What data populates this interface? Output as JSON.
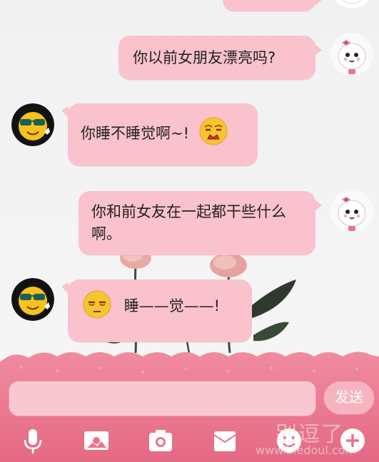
{
  "messages": [
    {
      "side": "right",
      "text": ""
    },
    {
      "side": "right",
      "text": "你以前女朋友漂亮吗?"
    },
    {
      "side": "left",
      "text": "你睡不睡觉啊~!",
      "emoji": "frustrated-face-emoji"
    },
    {
      "side": "right",
      "text": "你和前女友在一起都干些什么啊。"
    },
    {
      "side": "left",
      "text": "睡——觉——!",
      "emoji": "sleepy-face-emoji"
    }
  ],
  "input": {
    "placeholder": "",
    "value": ""
  },
  "send_label": "发送",
  "toolbar": [
    "microphone-icon",
    "image-icon",
    "camera-icon",
    "envelope-icon",
    "emoji-icon",
    "plus-icon"
  ],
  "watermark": {
    "line1": "别逗了",
    "line2": "www.biedoul.com"
  },
  "colors": {
    "bubble": "#f9c2cc",
    "panel": "#e9748b",
    "send": "#f6b3c0"
  }
}
